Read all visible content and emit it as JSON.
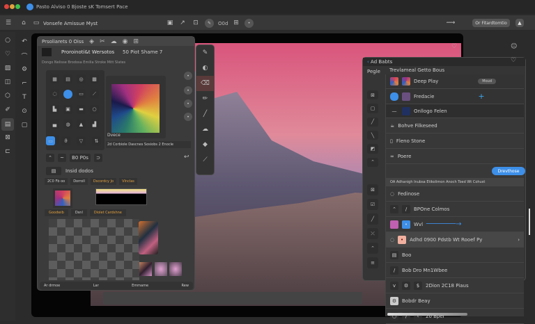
{
  "window": {
    "title": "Pasto Alviso 0 Bjoste sK Tomsert Pace"
  },
  "toolbar": {
    "doc_title": "Vonsefe Amissue Myst",
    "counter": "O0d",
    "action_button": "Or Fitardtomtio"
  },
  "left_panel": {
    "header": "Prsoliarets 0 Oiss",
    "subheader": "Proroinoti&t Wersotos",
    "subheader_right": "50 Piot Shame 7",
    "info": "Dongo Nelisse Brodosa Emilia Stroke Mitt Slates",
    "gradient_label": "Dvece",
    "swatch_info": "2d Corbiole Dascnes Sosiobs 2 Enocle",
    "controls_label": "B0 P0s",
    "layer_label": "Insid dodos",
    "tabs": [
      "2C0 Fb oo",
      "Dorroll",
      "Dscordcy Jo",
      "Vlnclas"
    ],
    "mid_labels": [
      "Goodwib",
      "Dsnl",
      "Diolet Cardshne"
    ],
    "footer": [
      "Ar drmoe",
      "Lar",
      "Emmame",
      "Rew"
    ]
  },
  "right_panel": {
    "header": "Ad Babts",
    "nav_label": "Pegle",
    "section_title": "Trevlameal Getto Bous",
    "rows": [
      "Deep Play",
      "Fredacie",
      "Onllogo Felen",
      "Bohve Filkeseed",
      "Fleno Stone",
      "Poere"
    ],
    "tag": "Moud",
    "status_text": "OA Adhanigh Inubsa Etikolimon Anoch  Toed Wt Cohust",
    "primary_button": "Drevthose",
    "list": [
      "Fedinose",
      "BPOne Colmos",
      "Wvl",
      "Adhd 0900 Pdstb Wt Rooef Py",
      "Boo",
      "Bob Dro Mn1Wbee",
      "2Dion 2C18 Piaus",
      "Bobdr Beay",
      "20 Bper"
    ]
  },
  "colors": {
    "accent": "#3d8fe8",
    "background": "#2b2b2b",
    "panel": "#3b3b3b"
  }
}
